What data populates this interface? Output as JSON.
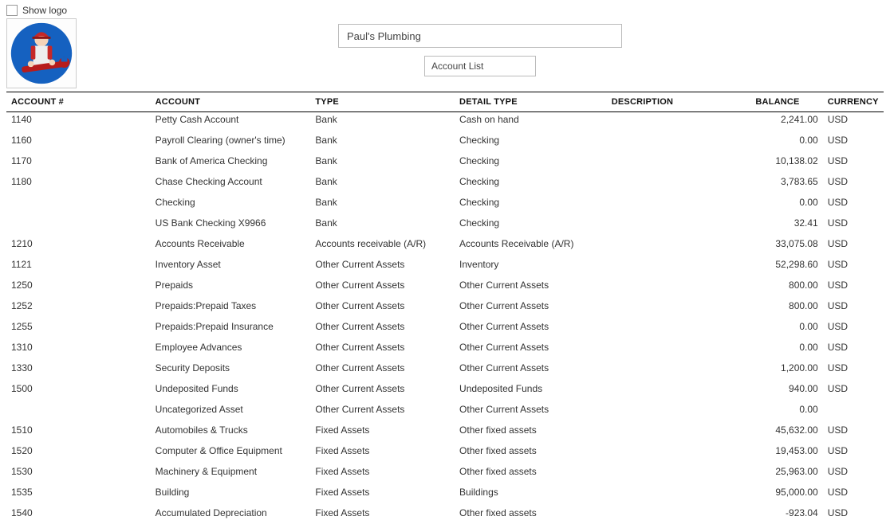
{
  "header": {
    "show_logo_label": "Show logo",
    "company_name": "Paul's Plumbing",
    "report_name": "Account List"
  },
  "columns": {
    "account_num": "ACCOUNT #",
    "account": "ACCOUNT",
    "type": "TYPE",
    "detail_type": "DETAIL TYPE",
    "description": "DESCRIPTION",
    "balance": "BALANCE",
    "currency": "CURRENCY"
  },
  "rows": [
    {
      "num": "1140",
      "account": "Petty Cash Account",
      "type": "Bank",
      "detail": "Cash on hand",
      "desc": "",
      "balance": "2,241.00",
      "currency": "USD"
    },
    {
      "num": "1160",
      "account": "Payroll Clearing (owner's time)",
      "type": "Bank",
      "detail": "Checking",
      "desc": "",
      "balance": "0.00",
      "currency": "USD"
    },
    {
      "num": "1170",
      "account": "Bank of America Checking",
      "type": "Bank",
      "detail": "Checking",
      "desc": "",
      "balance": "10,138.02",
      "currency": "USD"
    },
    {
      "num": "1180",
      "account": "Chase Checking Account",
      "type": "Bank",
      "detail": "Checking",
      "desc": "",
      "balance": "3,783.65",
      "currency": "USD"
    },
    {
      "num": "",
      "account": "Checking",
      "type": "Bank",
      "detail": "Checking",
      "desc": "",
      "balance": "0.00",
      "currency": "USD"
    },
    {
      "num": "",
      "account": "US Bank Checking X9966",
      "type": "Bank",
      "detail": "Checking",
      "desc": "",
      "balance": "32.41",
      "currency": "USD"
    },
    {
      "num": "1210",
      "account": "Accounts Receivable",
      "type": "Accounts receivable (A/R)",
      "detail": "Accounts Receivable (A/R)",
      "desc": "",
      "balance": "33,075.08",
      "currency": "USD"
    },
    {
      "num": "1121",
      "account": "Inventory Asset",
      "type": "Other Current Assets",
      "detail": "Inventory",
      "desc": "",
      "balance": "52,298.60",
      "currency": "USD"
    },
    {
      "num": "1250",
      "account": "Prepaids",
      "type": "Other Current Assets",
      "detail": "Other Current Assets",
      "desc": "",
      "balance": "800.00",
      "currency": "USD"
    },
    {
      "num": "1252",
      "account": "Prepaids:Prepaid Taxes",
      "type": "Other Current Assets",
      "detail": "Other Current Assets",
      "desc": "",
      "balance": "800.00",
      "currency": "USD"
    },
    {
      "num": "1255",
      "account": "Prepaids:Prepaid Insurance",
      "type": "Other Current Assets",
      "detail": "Other Current Assets",
      "desc": "",
      "balance": "0.00",
      "currency": "USD"
    },
    {
      "num": "1310",
      "account": "Employee Advances",
      "type": "Other Current Assets",
      "detail": "Other Current Assets",
      "desc": "",
      "balance": "0.00",
      "currency": "USD"
    },
    {
      "num": "1330",
      "account": "Security Deposits",
      "type": "Other Current Assets",
      "detail": "Other Current Assets",
      "desc": "",
      "balance": "1,200.00",
      "currency": "USD"
    },
    {
      "num": "1500",
      "account": "Undeposited Funds",
      "type": "Other Current Assets",
      "detail": "Undeposited Funds",
      "desc": "",
      "balance": "940.00",
      "currency": "USD"
    },
    {
      "num": "",
      "account": "Uncategorized Asset",
      "type": "Other Current Assets",
      "detail": "Other Current Assets",
      "desc": "",
      "balance": "0.00",
      "currency": ""
    },
    {
      "num": "1510",
      "account": "Automobiles & Trucks",
      "type": "Fixed Assets",
      "detail": "Other fixed assets",
      "desc": "",
      "balance": "45,632.00",
      "currency": "USD"
    },
    {
      "num": "1520",
      "account": "Computer & Office Equipment",
      "type": "Fixed Assets",
      "detail": "Other fixed assets",
      "desc": "",
      "balance": "19,453.00",
      "currency": "USD"
    },
    {
      "num": "1530",
      "account": "Machinery & Equipment",
      "type": "Fixed Assets",
      "detail": "Other fixed assets",
      "desc": "",
      "balance": "25,963.00",
      "currency": "USD"
    },
    {
      "num": "1535",
      "account": "Building",
      "type": "Fixed Assets",
      "detail": "Buildings",
      "desc": "",
      "balance": "95,000.00",
      "currency": "USD"
    },
    {
      "num": "1540",
      "account": "Accumulated Depreciation",
      "type": "Fixed Assets",
      "detail": "Other fixed assets",
      "desc": "",
      "balance": "-923.04",
      "currency": "USD"
    }
  ]
}
